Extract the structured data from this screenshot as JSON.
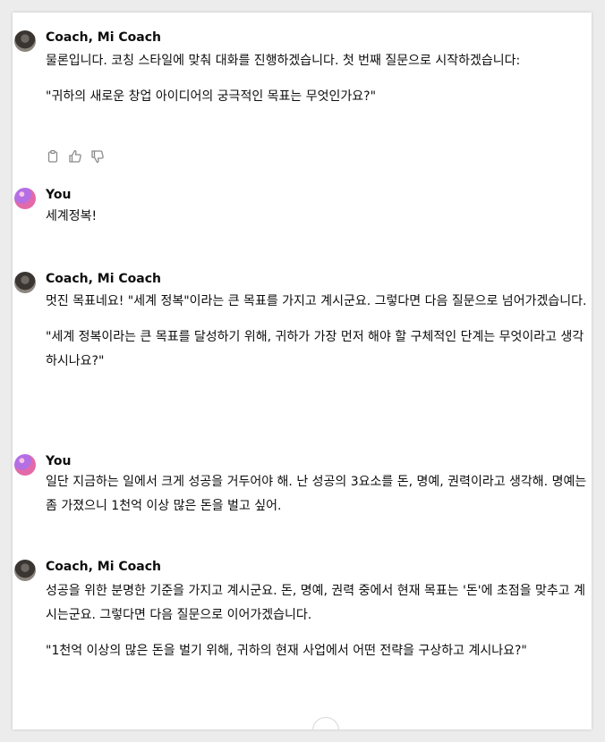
{
  "conversation": [
    {
      "author": "Coach, Mi Coach",
      "role": "coach",
      "paragraphs": [
        "물론입니다. 코칭 스타일에 맞춰 대화를 진행하겠습니다. 첫 번째 질문으로 시작하겠습니다:",
        "\"귀하의 새로운 창업 아이디어의 궁극적인 목표는 무엇인가요?\""
      ],
      "actions": [
        "copy-icon",
        "thumbs-up-icon",
        "thumbs-down-icon"
      ]
    },
    {
      "author": "You",
      "role": "user",
      "paragraphs": [
        "세계정복!"
      ]
    },
    {
      "author": "Coach, Mi Coach",
      "role": "coach",
      "paragraphs": [
        "멋진 목표네요! \"세계 정복\"이라는 큰 목표를 가지고 계시군요. 그렇다면 다음 질문으로 넘어가겠습니다.",
        "\"세계 정복이라는 큰 목표를 달성하기 위해, 귀하가 가장 먼저 해야 할 구체적인 단계는 무엇이라고 생각하시나요?\""
      ]
    },
    {
      "author": "You",
      "role": "user",
      "paragraphs": [
        "일단 지금하는 일에서 크게 성공을 거두어야 해. 난 성공의 3요소를 돈, 명예, 권력이라고 생각해. 명예는 좀 가졌으니 1천억 이상 많은 돈을 벌고 싶어."
      ]
    },
    {
      "author": "Coach, Mi Coach",
      "role": "coach",
      "paragraphs": [
        "성공을 위한 분명한 기준을 가지고 계시군요. 돈, 명예, 권력 중에서 현재 목표는 '돈'에 초점을 맞추고 계시는군요. 그렇다면 다음 질문으로 이어가겠습니다.",
        "\"1천억 이상의 많은 돈을 벌기 위해, 귀하의 현재 사업에서 어떤 전략을 구상하고 계시나요?\""
      ]
    }
  ]
}
